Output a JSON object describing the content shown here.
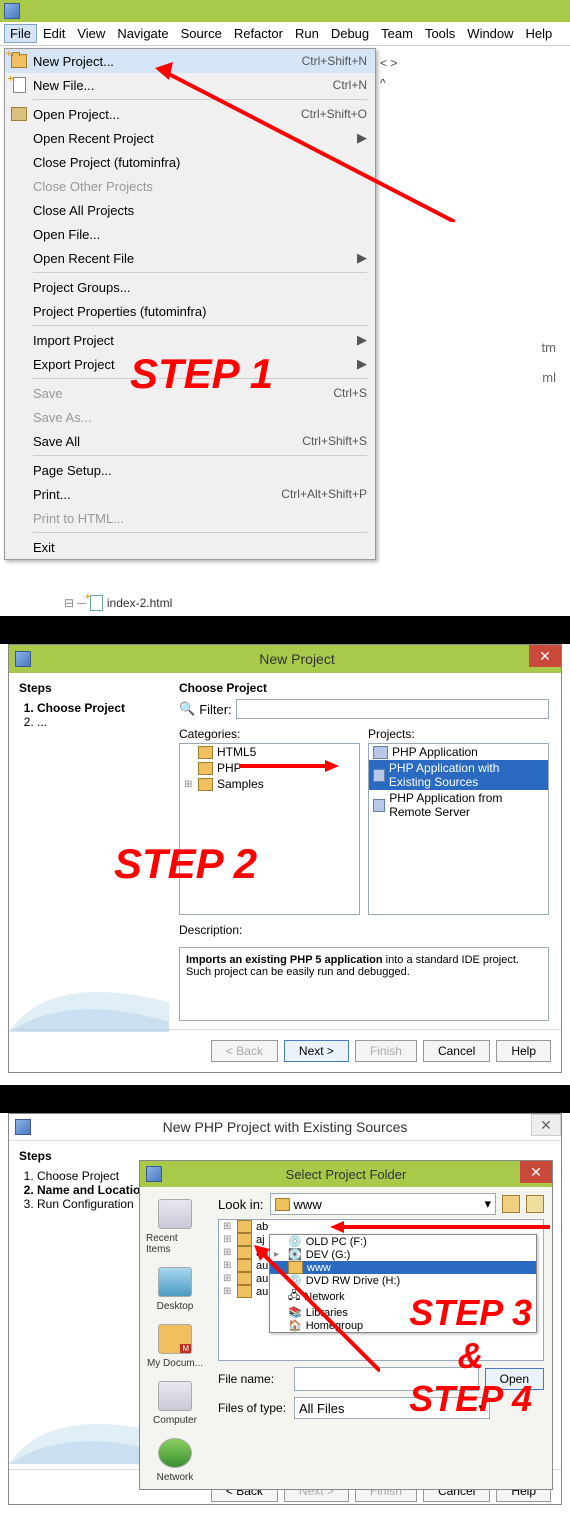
{
  "menubar": [
    "File",
    "Edit",
    "View",
    "Navigate",
    "Source",
    "Refactor",
    "Run",
    "Debug",
    "Team",
    "Tools",
    "Window",
    "Help"
  ],
  "file_menu": {
    "new_project": {
      "label": "New Project...",
      "shortcut": "Ctrl+Shift+N"
    },
    "new_file": {
      "label": "New File...",
      "shortcut": "Ctrl+N"
    },
    "open_project": {
      "label": "Open Project...",
      "shortcut": "Ctrl+Shift+O"
    },
    "open_recent_project": {
      "label": "Open Recent Project"
    },
    "close_project": {
      "label": "Close Project (futominfra)"
    },
    "close_other": {
      "label": "Close Other Projects"
    },
    "close_all": {
      "label": "Close All Projects"
    },
    "open_file": {
      "label": "Open File..."
    },
    "open_recent_file": {
      "label": "Open Recent File"
    },
    "project_groups": {
      "label": "Project Groups..."
    },
    "project_props": {
      "label": "Project Properties (futominfra)"
    },
    "import": {
      "label": "Import Project"
    },
    "export": {
      "label": "Export Project"
    },
    "save": {
      "label": "Save",
      "shortcut": "Ctrl+S"
    },
    "save_as": {
      "label": "Save As..."
    },
    "save_all": {
      "label": "Save All",
      "shortcut": "Ctrl+Shift+S"
    },
    "page_setup": {
      "label": "Page Setup..."
    },
    "print": {
      "label": "Print...",
      "shortcut": "Ctrl+Alt+Shift+P"
    },
    "print_html": {
      "label": "Print to HTML..."
    },
    "exit": {
      "label": "Exit"
    }
  },
  "bg": {
    "htm": "tm",
    "ml": "ml",
    "tree_item": "index-2.html",
    "nav_frag": "< >"
  },
  "steps": {
    "s1": "STEP 1",
    "s2": "STEP 2",
    "s34": "STEP 3\n&\nSTEP 4"
  },
  "dlg2": {
    "title": "New Project",
    "steps_h": "Steps",
    "steps": [
      "Choose Project",
      "..."
    ],
    "choose": "Choose Project",
    "filter": "Filter:",
    "cat_lbl": "Categories:",
    "proj_lbl": "Projects:",
    "cats": [
      "HTML5",
      "PHP",
      "Samples"
    ],
    "projs": [
      "PHP Application",
      "PHP Application with Existing Sources",
      "PHP Application from Remote Server"
    ],
    "desc_lbl": "Description:",
    "desc_bold": "Imports an existing PHP 5 application",
    "desc_rest": " into a standard IDE project. Such project can be easily run and debugged.",
    "back": "< Back",
    "next": "Next >",
    "finish": "Finish",
    "cancel": "Cancel",
    "help": "Help"
  },
  "dlg3": {
    "title": "New PHP Project with Existing Sources",
    "steps_h": "Steps",
    "steps": [
      "Choose Project",
      "Name and Location",
      "Run Configuration"
    ],
    "inner_title": "Select Project Folder",
    "icons": [
      "Recent Items",
      "Desktop",
      "My Docum...",
      "Computer",
      "Network"
    ],
    "look_in": "Look in:",
    "look_val": "www",
    "tree_left": [
      "ab",
      "aj",
      "au",
      "au",
      "au",
      "au"
    ],
    "drop": [
      "OLD PC (F:)",
      "DEV (G:)",
      "www",
      "DVD RW Drive (H:)",
      "Network",
      "Libraries",
      "Homegroup"
    ],
    "file_name": "File name:",
    "files_type": "Files of type:",
    "files_type_val": "All Files",
    "open": "Open",
    "back": "< Back",
    "next": "Next >",
    "finish": "Finish",
    "cancel": "Cancel",
    "help": "Help"
  }
}
